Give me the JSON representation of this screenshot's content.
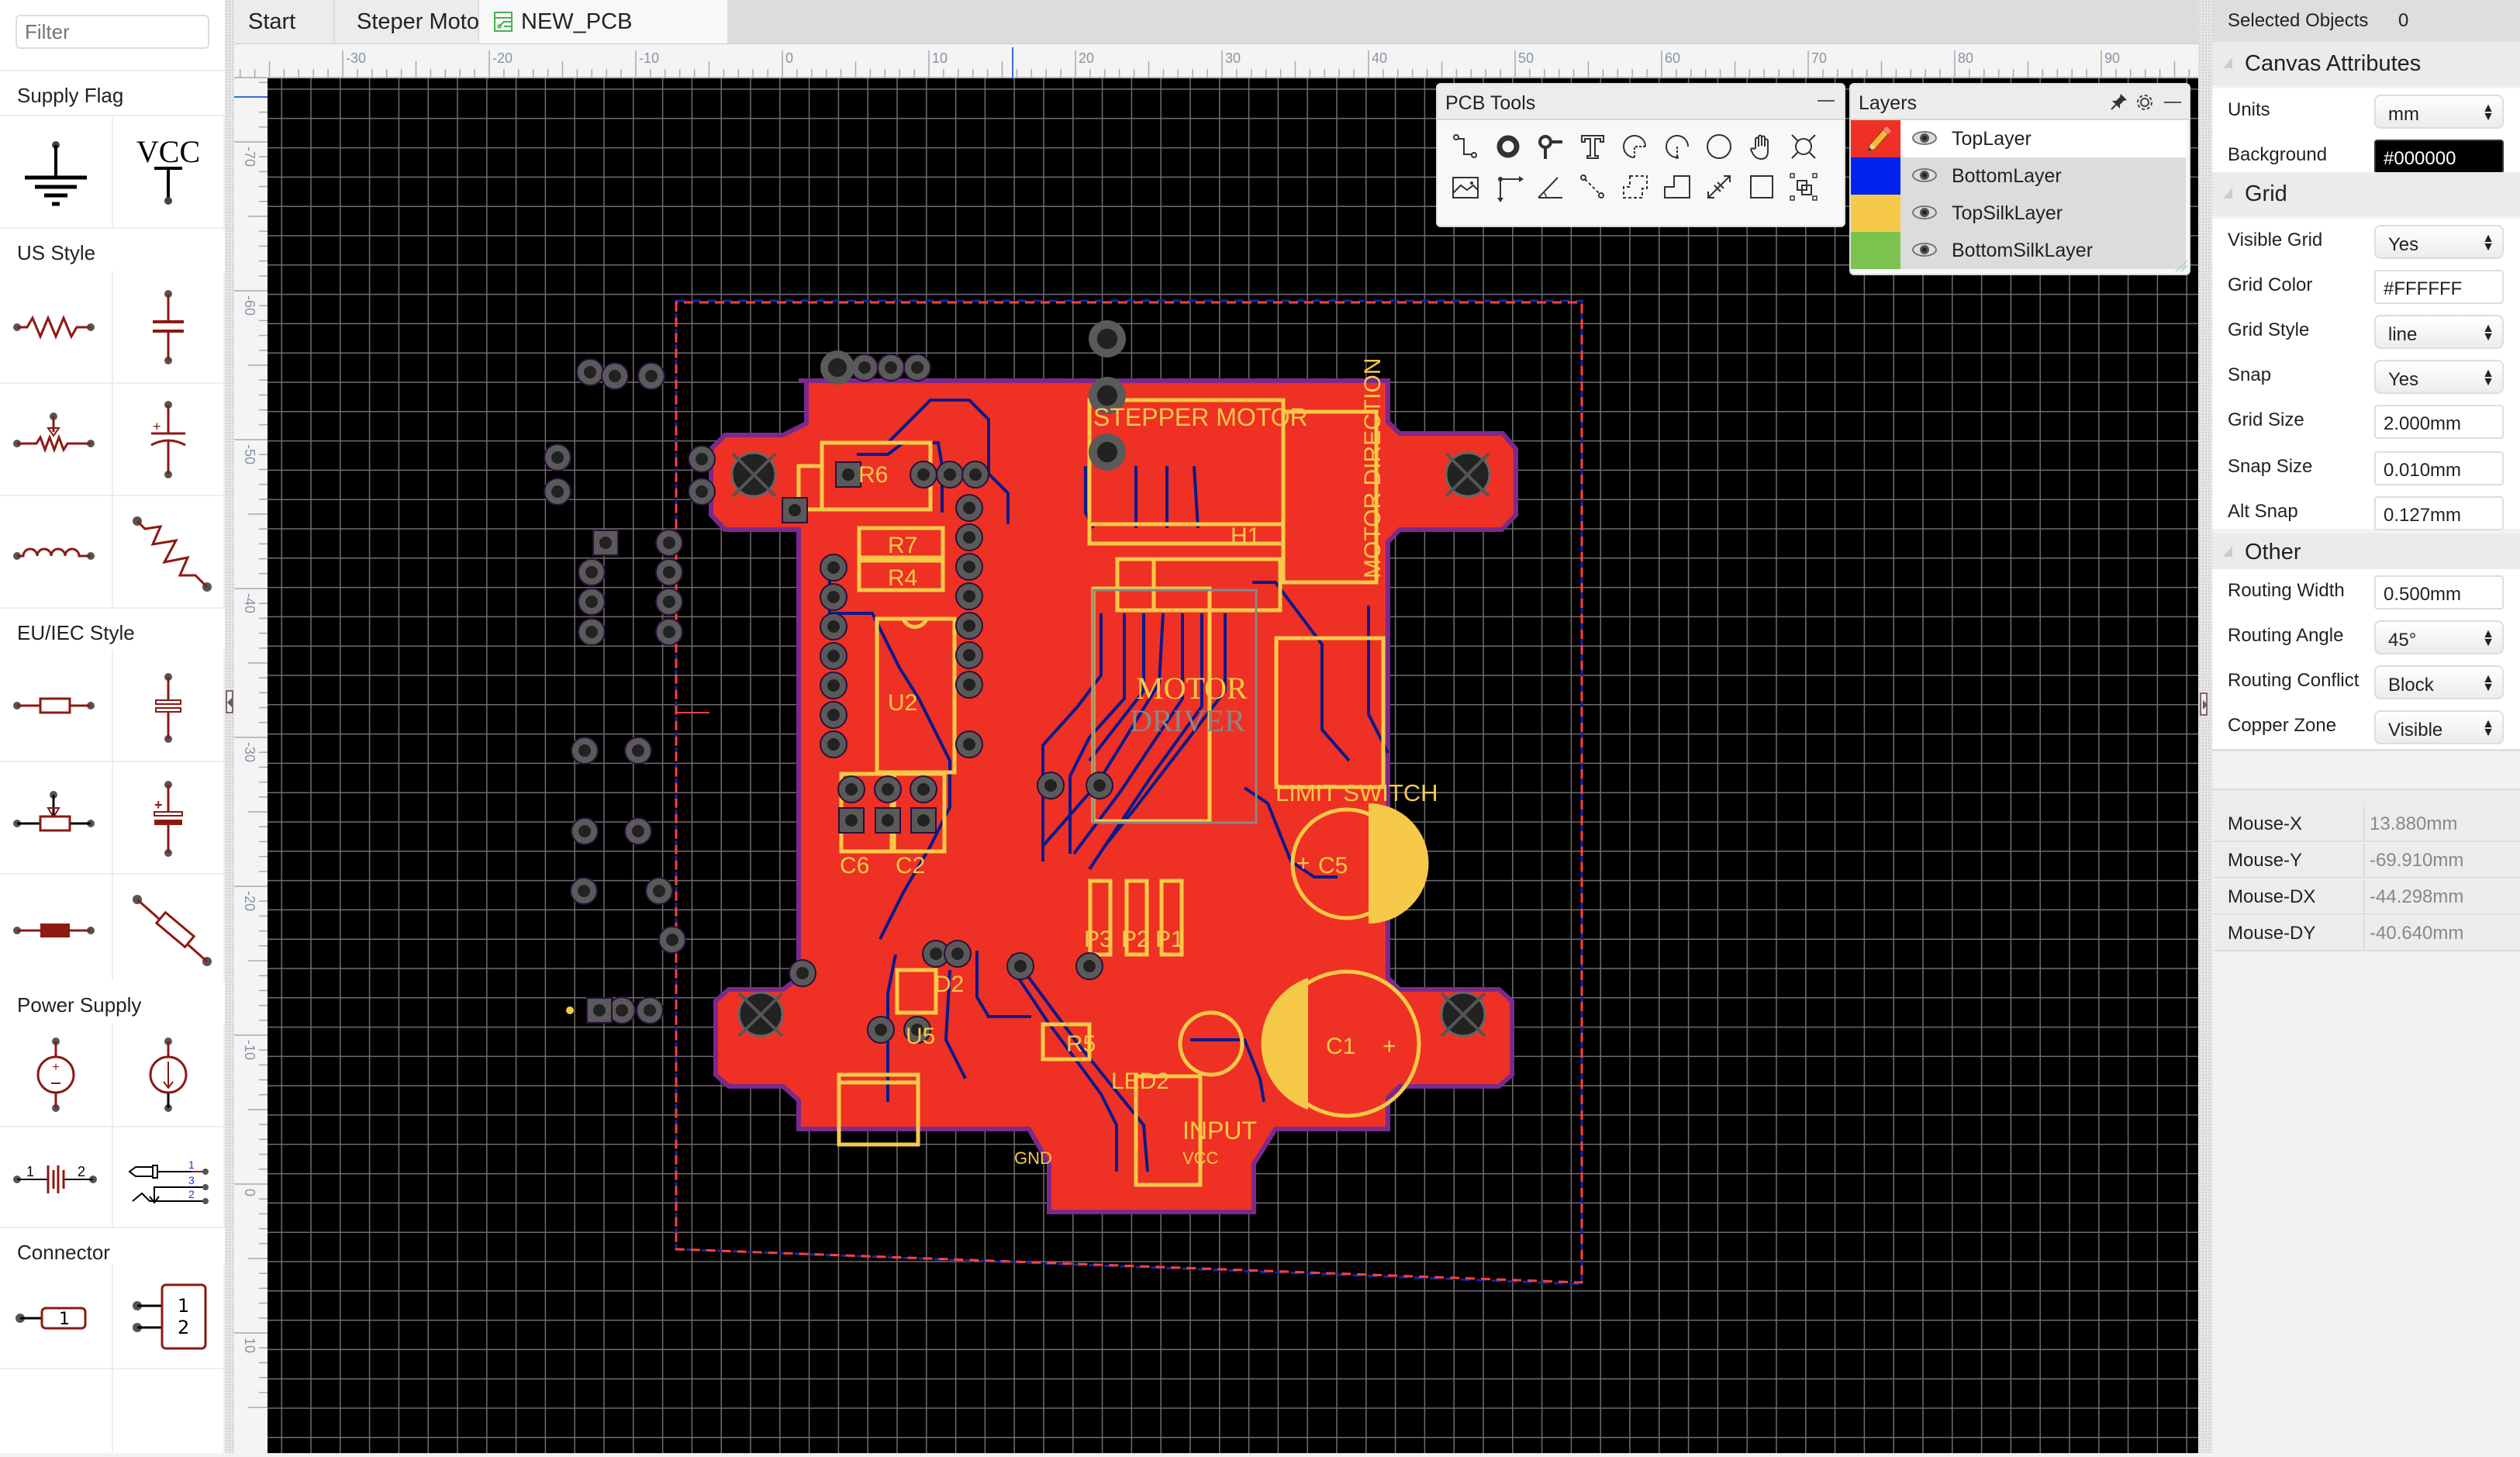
{
  "sidebar": {
    "filter_placeholder": "Filter",
    "sections": [
      {
        "title": "Supply Flag",
        "items": [
          "ground-symbol",
          "vcc-symbol"
        ],
        "vcc_text": "VCC"
      },
      {
        "title": "US Style",
        "items": [
          "resistor-us",
          "capacitor-us",
          "potentiometer-us",
          "polarized-capacitor-us",
          "inductor-us",
          "resistor-us-diagonal"
        ]
      },
      {
        "title": "EU/IEC Style",
        "items": [
          "resistor-eu",
          "capacitor-eu",
          "potentiometer-eu",
          "polarized-capacitor-eu",
          "filled-resistor-eu",
          "resistor-eu-diagonal"
        ]
      },
      {
        "title": "Power Supply",
        "items": [
          "voltage-source",
          "current-source",
          "battery",
          "audio-jack"
        ],
        "battery_pins": [
          "1",
          "2"
        ],
        "jack_pins": [
          "1",
          "3",
          "2"
        ]
      },
      {
        "title": "Connector",
        "items": [
          "connector-1pin",
          "connector-2pin"
        ],
        "connector_1pin_labels": [
          "1"
        ],
        "connector_2pin_labels": [
          "1",
          "2"
        ]
      }
    ]
  },
  "tabs": [
    {
      "label": "Start",
      "icon": null,
      "active": false
    },
    {
      "label": "Steper Motor con...",
      "icon": "schematic-icon",
      "active": false
    },
    {
      "label": "NEW_PCB",
      "icon": "pcb-icon",
      "active": true
    }
  ],
  "rulers": {
    "top_labels": [
      "-30",
      "-20",
      "-10",
      "0",
      "10",
      "20",
      "30",
      "40",
      "50",
      "60",
      "70",
      "80",
      "90"
    ],
    "left_labels": [
      "-70",
      "-60",
      "-50",
      "-40",
      "-30",
      "-20",
      "-10",
      "0",
      "10"
    ]
  },
  "pcb_tools": {
    "title": "PCB Tools",
    "tools": [
      "track-tool",
      "pad-tool",
      "via-tool",
      "text-tool",
      "arc-tool",
      "center-arc-tool",
      "circle-tool",
      "pan-tool",
      "hole-tool",
      "image-tool",
      "canvas-origin-tool",
      "protractor-tool",
      "connect-pad-tool",
      "copper-area-tool",
      "solid-region-tool",
      "dimension-tool",
      "rectangle-tool",
      "group-tool"
    ]
  },
  "layers": {
    "title": "Layers",
    "items": [
      {
        "name": "TopLayer",
        "color": "#EE3124",
        "active": true
      },
      {
        "name": "BottomLayer",
        "color": "#0022EE",
        "active": false
      },
      {
        "name": "TopSilkLayer",
        "color": "#F7C948",
        "active": false
      },
      {
        "name": "BottomSilkLayer",
        "color": "#7CC24E",
        "active": false
      }
    ]
  },
  "board": {
    "labels": {
      "stepper_motor": "STEPPER MOTOR",
      "motor_direction": "MOTOR DIRECTION",
      "limit_switch": "LIMIT SWITCH",
      "motor_driver_1": "MOTOR",
      "motor_driver_2": "DRIVER",
      "input": "INPUT",
      "gnd": "GND",
      "vcc": "VCC",
      "r6": "R6",
      "r7": "R7",
      "r4": "R4",
      "u2": "U2",
      "h1": "H1",
      "c6": "C6",
      "c2": "C2",
      "c5": "C5",
      "c1": "C1",
      "p3": "P3",
      "p2": "P2",
      "p1": "P1",
      "d2": "D2",
      "r5": "R5",
      "u5": "U5",
      "led2": "LED2"
    },
    "colors": {
      "copper_top": "#EE3124",
      "bottom_trace": "#0B1A8C",
      "silk": "#F7C948",
      "outline": "#7B2A8C",
      "pad": "#5A5A5A"
    }
  },
  "right_panel": {
    "selected_objects_label": "Selected Objects",
    "selected_objects_value": "0",
    "canvas_attributes": {
      "title": "Canvas Attributes",
      "units_label": "Units",
      "units_value": "mm",
      "background_label": "Background",
      "background_value": "#000000"
    },
    "grid": {
      "title": "Grid",
      "visible_label": "Visible Grid",
      "visible_value": "Yes",
      "color_label": "Grid Color",
      "color_value": "#FFFFFF",
      "style_label": "Grid Style",
      "style_value": "line",
      "snap_label": "Snap",
      "snap_value": "Yes",
      "size_label": "Grid Size",
      "size_value": "2.000mm",
      "snap_size_label": "Snap Size",
      "snap_size_value": "0.010mm",
      "alt_snap_label": "Alt Snap",
      "alt_snap_value": "0.127mm"
    },
    "other": {
      "title": "Other",
      "routing_width_label": "Routing Width",
      "routing_width_value": "0.500mm",
      "routing_angle_label": "Routing Angle",
      "routing_angle_value": "45°",
      "routing_conflict_label": "Routing Conflict",
      "routing_conflict_value": "Block",
      "copper_zone_label": "Copper Zone",
      "copper_zone_value": "Visible"
    },
    "mouse": [
      {
        "label": "Mouse-X",
        "value": "13.880mm"
      },
      {
        "label": "Mouse-Y",
        "value": "-69.910mm"
      },
      {
        "label": "Mouse-DX",
        "value": "-44.298mm"
      },
      {
        "label": "Mouse-DY",
        "value": "-40.640mm"
      }
    ]
  }
}
